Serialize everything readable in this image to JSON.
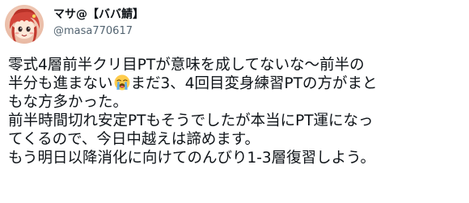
{
  "user": {
    "display_name": "マサ@【ババ鯖】",
    "handle": "@masa770617",
    "avatar_icon": "anime-character-avatar-icon"
  },
  "tweet": {
    "line1": "零式4層前半クリ目PTが意味を成してないな～前半の",
    "line2_before_emoji": "半分も進まない",
    "emoji": "loudly-crying-face-icon",
    "line2_after_emoji": "まだ3、4回目変身練習PTの方がまと",
    "line3": "もな方多かった。",
    "line4": "前半時間切れ安定PTもそうでしたが本当にPT運になっ",
    "line5": "てくるので、今日中越えは諦めます。",
    "line6": "もう明日以降消化に向けてのんびり1-3層復習しよう。"
  },
  "colors": {
    "text": "#0f1419",
    "secondary": "#536471",
    "background": "#ffffff"
  }
}
